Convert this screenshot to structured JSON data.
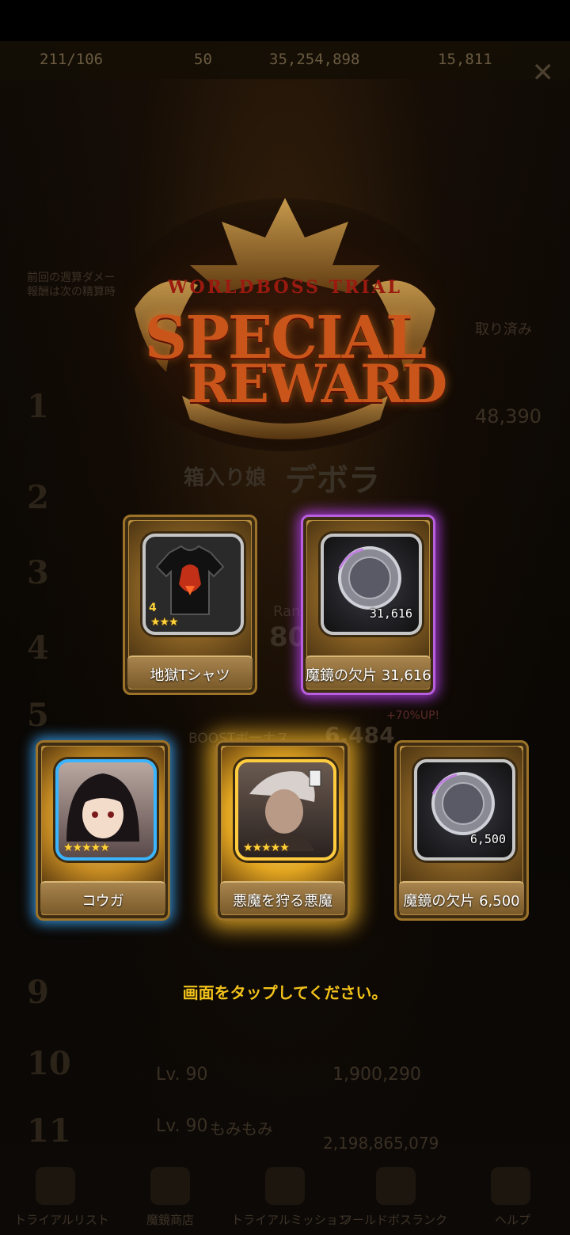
{
  "topbar": {
    "stamina": "211/106",
    "stat2": "50",
    "gold": "35,254,898",
    "gems": "15,811"
  },
  "background": {
    "info_line1": "前回の週算ダメー",
    "info_line2": "報酬は次の精算時",
    "claimed": "取り済み",
    "score_top": "48,390",
    "rank_label": "Rank",
    "rank_value": "80",
    "boost_label": "BOOSTボーナス",
    "boost_value": "6,484",
    "boost_pct": "+70%UP!",
    "row10_level": "Lv. 90",
    "row10_score": "1,900,290",
    "row11_level": "Lv. 90",
    "row11_name": "もみもみ",
    "row11_score": "2,198,865,079",
    "rank_numbers": [
      "1",
      "2",
      "3",
      "4",
      "5",
      "9",
      "10",
      "11"
    ]
  },
  "title": {
    "small": "WORLDBOSS TRIAL",
    "line1": "SPECIAL",
    "line2": "REWARD",
    "boss_tag": "箱入り娘",
    "boss_name": "デボラ"
  },
  "rewards": [
    {
      "label": "地獄Tシャツ",
      "level": "4",
      "rarity": "★★★",
      "count": "",
      "icon": "tshirt-icon",
      "glow": "none"
    },
    {
      "label": "魔鏡の欠片 31,616",
      "level": "",
      "rarity": "",
      "count": "31,616",
      "icon": "mirror-shard-icon",
      "glow": "#aa3cdc"
    },
    {
      "label": "コウガ",
      "level": "",
      "rarity": "★★★★★",
      "count": "",
      "icon": "character-portrait",
      "glow": "#3caaff"
    },
    {
      "label": "悪魔を狩る悪魔",
      "level": "",
      "rarity": "★★★★★",
      "count": "",
      "icon": "character-portrait",
      "glow": "#ffbe28"
    },
    {
      "label": "魔鏡の欠片 6,500",
      "level": "",
      "rarity": "",
      "count": "6,500",
      "icon": "mirror-shard-icon",
      "glow": "none"
    }
  ],
  "prompt": "画面をタップしてください。",
  "nav": [
    "トライアルリスト",
    "魔鏡商店",
    "トライアルミッション",
    "ワールドボスランク",
    "ヘルプ"
  ]
}
